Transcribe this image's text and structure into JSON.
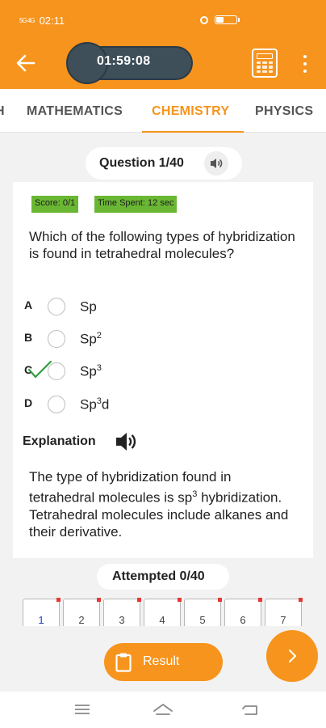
{
  "status_bar": {
    "network": "5G 4G",
    "time": "02:11",
    "battery_level": 0.4
  },
  "app_bar": {
    "timer": "01:59:08"
  },
  "tabs": [
    {
      "label": "H",
      "active": false
    },
    {
      "label": "MATHEMATICS",
      "active": false
    },
    {
      "label": "CHEMISTRY",
      "active": true
    },
    {
      "label": "PHYSICS",
      "active": false
    }
  ],
  "question_header": {
    "label": "Question 1/40"
  },
  "card": {
    "score": "Score: 0/1",
    "time_spent": "Time Spent: 12 sec",
    "question": "Which of the following types of hybridization is found in tetrahedral molecules?",
    "options": [
      {
        "letter": "A",
        "text": "Sp",
        "sup": "",
        "suffix": "",
        "correct": false
      },
      {
        "letter": "B",
        "text": "Sp",
        "sup": "2",
        "suffix": "",
        "correct": false
      },
      {
        "letter": "C",
        "text": "Sp",
        "sup": "3",
        "suffix": "",
        "correct": true
      },
      {
        "letter": "D",
        "text": "Sp",
        "sup": "3",
        "suffix": "d",
        "correct": false
      }
    ],
    "explanation_title": "Explanation",
    "explanation_text_1": "The type of hybridization found in tetrahedral molecules is sp",
    "explanation_sup": "3",
    "explanation_text_2": " hybridization. Tetrahedral molecules include alkanes and their derivative."
  },
  "attempted": {
    "label": "Attempted 0/40"
  },
  "question_numbers": [
    "1",
    "2",
    "3",
    "4",
    "5",
    "6",
    "7"
  ],
  "current_question": "1",
  "result_button": {
    "label": "Result"
  },
  "colors": {
    "accent": "#f7941d",
    "badge_green": "#6ab733",
    "timer_bg": "#3e4f5a",
    "correct_check": "#2e9e3e"
  },
  "icons": [
    "back-arrow-icon",
    "calculator-icon",
    "more-vert-icon",
    "speaker-icon",
    "clipboard-icon",
    "chevron-right-icon",
    "menu-icon",
    "home-icon",
    "back-icon"
  ]
}
